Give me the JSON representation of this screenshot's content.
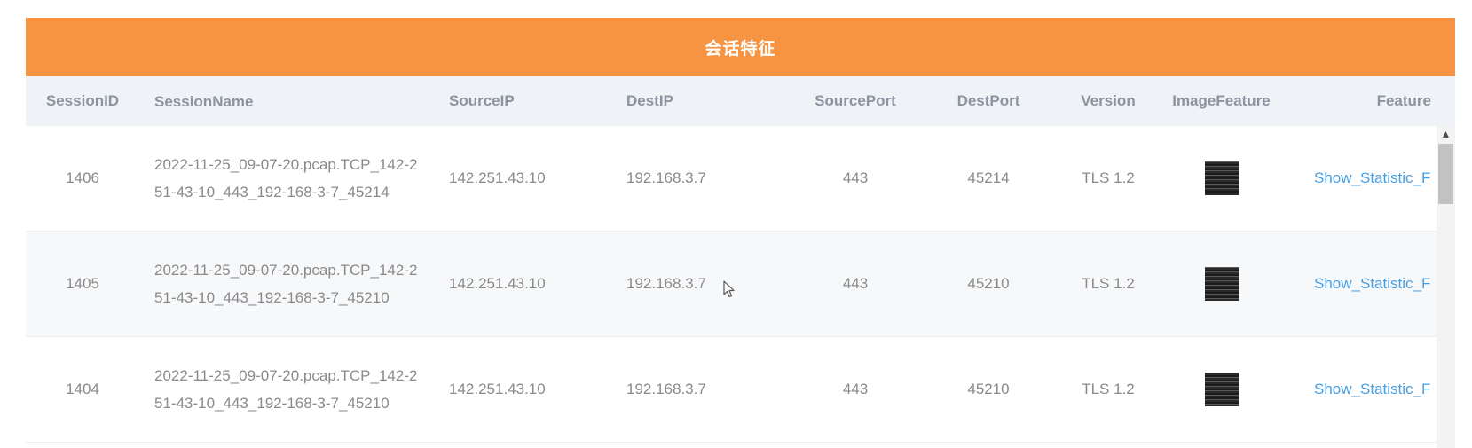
{
  "panel": {
    "title": "会话特征"
  },
  "columns": [
    "SessionID",
    "SessionName",
    "SourceIP",
    "DestIP",
    "SourcePort",
    "DestPort",
    "Version",
    "ImageFeature",
    "Feature"
  ],
  "rows": [
    {
      "id": "1406",
      "name": "2022-11-25_09-07-20.pcap.TCP_142-251-43-10_443_192-168-3-7_45214",
      "source_ip": "142.251.43.10",
      "dest_ip": "192.168.3.7",
      "source_port": "443",
      "dest_port": "45214",
      "version": "TLS 1.2",
      "feature_link": "Show_Statistic_F"
    },
    {
      "id": "1405",
      "name": "2022-11-25_09-07-20.pcap.TCP_142-251-43-10_443_192-168-3-7_45210",
      "source_ip": "142.251.43.10",
      "dest_ip": "192.168.3.7",
      "source_port": "443",
      "dest_port": "45210",
      "version": "TLS 1.2",
      "feature_link": "Show_Statistic_F"
    },
    {
      "id": "1404",
      "name": "2022-11-25_09-07-20.pcap.TCP_142-251-43-10_443_192-168-3-7_45210",
      "source_ip": "142.251.43.10",
      "dest_ip": "192.168.3.7",
      "source_port": "443",
      "dest_port": "45210",
      "version": "TLS 1.2",
      "feature_link": "Show_Statistic_F"
    }
  ],
  "scrollbar": {
    "up_arrow": "▲"
  },
  "colors": {
    "title_bar": "#f79444",
    "header_bg": "#eff3f7",
    "link": "#4a9fe0"
  },
  "icons": {
    "image_feature": "image-thumbnail-icon",
    "cursor": "mouse-pointer-icon"
  }
}
